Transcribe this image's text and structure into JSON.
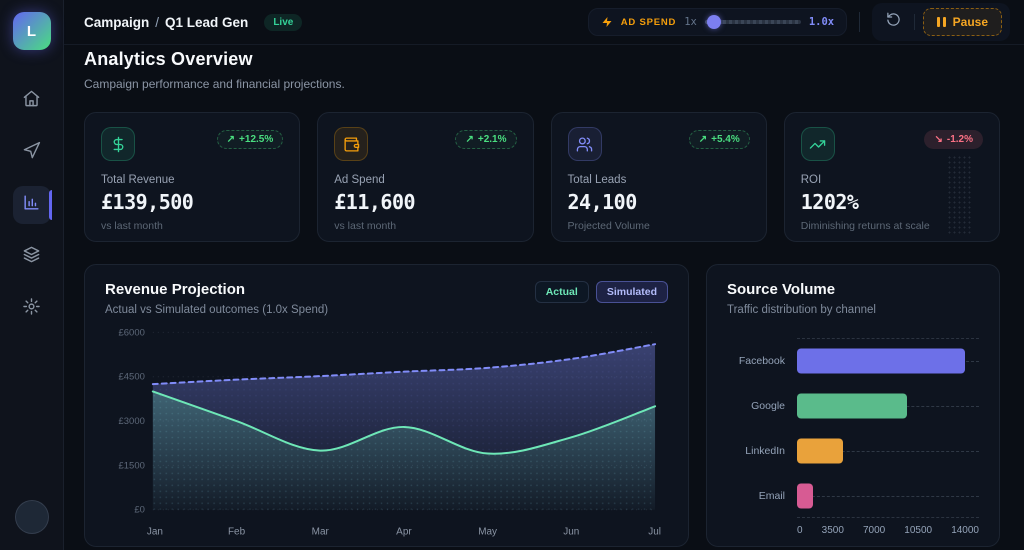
{
  "app": {
    "accent": "#6366f1"
  },
  "sidebar": {
    "logo_letter": "L",
    "items": [
      {
        "name": "home",
        "active": false
      },
      {
        "name": "campaigns",
        "active": false
      },
      {
        "name": "analytics",
        "active": true
      },
      {
        "name": "layers",
        "active": false
      },
      {
        "name": "settings",
        "active": false
      }
    ]
  },
  "header": {
    "breadcrumb_section": "Campaign",
    "breadcrumb_separator": "/",
    "breadcrumb_page": "Q1 Lead Gen",
    "live_badge": "Live",
    "ad_spend": {
      "label": "AD SPEND",
      "base": "1x",
      "value": "1.0x"
    },
    "pause_label": "Pause"
  },
  "page": {
    "title": "Analytics Overview",
    "subtitle": "Campaign performance and financial projections."
  },
  "stats": [
    {
      "icon": "dollar-icon",
      "accent": "#34d399",
      "label": "Total Revenue",
      "value": "£139,500",
      "arrow": "↗",
      "delta": "+12.5%",
      "delta_dir": "up",
      "footnote": "vs last month"
    },
    {
      "icon": "wallet-icon",
      "accent": "#f59e0b",
      "label": "Ad Spend",
      "value": "£11,600",
      "arrow": "↗",
      "delta": "+2.1%",
      "delta_dir": "up",
      "footnote": "vs last month"
    },
    {
      "icon": "users-icon",
      "accent": "#818cf8",
      "label": "Total Leads",
      "value": "24,100",
      "arrow": "↗",
      "delta": "+5.4%",
      "delta_dir": "up",
      "footnote": "Projected Volume"
    },
    {
      "icon": "trend-up-icon",
      "accent": "#34d399",
      "label": "ROI",
      "value": "1202%",
      "arrow": "↘",
      "delta": "-1.2%",
      "delta_dir": "down",
      "footnote": "Diminishing returns at scale"
    }
  ],
  "revenue_panel": {
    "title": "Revenue Projection",
    "subtitle": "Actual vs Simulated outcomes (1.0x Spend)",
    "legend": [
      {
        "label": "Actual",
        "color": "#6ee7b7"
      },
      {
        "label": "Simulated",
        "color": "#a5b4fc"
      }
    ]
  },
  "source_panel": {
    "title": "Source Volume",
    "subtitle": "Traffic distribution by channel"
  },
  "chart_data": [
    {
      "type": "area",
      "title": "Revenue Projection",
      "x": [
        "Jan",
        "Feb",
        "Mar",
        "Apr",
        "May",
        "Jun",
        "Jul"
      ],
      "y_ticks": [
        0,
        1500,
        3000,
        4500,
        6000
      ],
      "ylim": [
        0,
        6000
      ],
      "y_prefix": "£",
      "grid": true,
      "legend_position": "top-right",
      "series": [
        {
          "name": "Simulated",
          "color": "#818cf8",
          "style": "dashed",
          "values": [
            4250,
            4400,
            4520,
            4670,
            4800,
            5100,
            5600
          ]
        },
        {
          "name": "Actual",
          "color": "#6ee7b7",
          "style": "solid",
          "values": [
            4000,
            3000,
            2000,
            2800,
            1900,
            2450,
            3500
          ]
        }
      ]
    },
    {
      "type": "bar",
      "orientation": "horizontal",
      "title": "Source Volume",
      "categories": [
        "Facebook",
        "Google",
        "LinkedIn",
        "Email"
      ],
      "values": [
        12900,
        8500,
        3500,
        1200
      ],
      "colors": [
        "#6d70e8",
        "#5abb8b",
        "#e9a23b",
        "#d75b93"
      ],
      "x_ticks": [
        0,
        3500,
        7000,
        10500,
        14000
      ],
      "xlim": [
        0,
        14000
      ],
      "grid": true
    }
  ]
}
